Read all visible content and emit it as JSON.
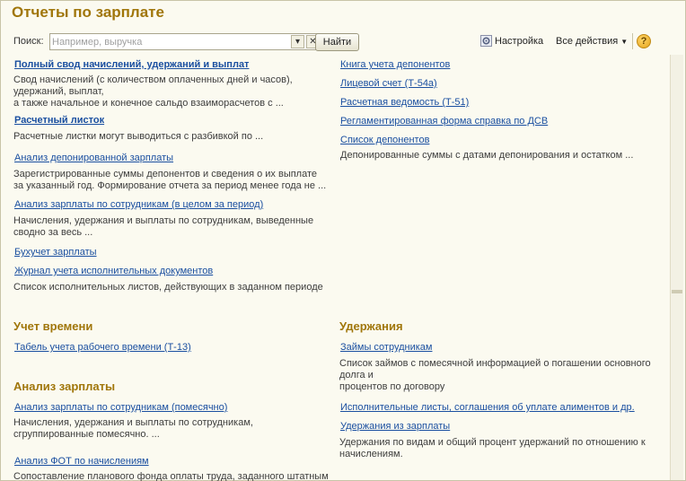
{
  "title": "Отчеты по зарплате",
  "toolbar": {
    "search_label": "Поиск:",
    "search_placeholder": "Например, выручка",
    "find_label": "Найти",
    "settings_label": "Настройка",
    "all_actions_label": "Все действия",
    "help_label": "?"
  },
  "left": {
    "items": [
      {
        "link": "Полный свод начислений, удержаний и выплат",
        "desc": [
          "Свод начислений (с количеством оплаченных дней и часов),",
          "удержаний, выплат,",
          "а также начальное и конечное сальдо взаиморасчетов с ..."
        ]
      },
      {
        "link": "Расчетный листок",
        "desc": [
          "Расчетные листки могут выводиться с разбивкой по ..."
        ]
      },
      {
        "link": "Анализ депонированной зарплаты",
        "desc": [
          "Зарегистрированные суммы депонентов и сведения о их выплате",
          "за указанный год. Формирование отчета за период менее года не ..."
        ]
      },
      {
        "link": "Анализ зарплаты по сотрудникам (в целом за период)",
        "desc": [
          "Начисления, удержания и выплаты по сотрудникам, выведенные",
          "сводно за весь ..."
        ]
      },
      {
        "link": "Бухучет зарплаты",
        "desc": []
      },
      {
        "link": "Журнал учета исполнительных документов",
        "desc": [
          "Список исполнительных листов, действующих в заданном периоде"
        ]
      }
    ]
  },
  "right": {
    "items": [
      {
        "link": "Книга учета депонентов"
      },
      {
        "link": "Лицевой счет (Т-54а)"
      },
      {
        "link": "Расчетная ведомость (Т-51)"
      },
      {
        "link": "Регламентированная форма справка по ДСВ"
      },
      {
        "link": "Список депонентов",
        "desc": [
          "Депонированные суммы с датами депонирования и остатком ..."
        ]
      }
    ]
  },
  "time": {
    "heading": "Учет времени",
    "items": [
      {
        "link": "Табель учета рабочего времени (Т-13)"
      }
    ]
  },
  "analysis": {
    "heading": "Анализ зарплаты",
    "items": [
      {
        "link": "Анализ зарплаты по сотрудникам (помесячно)",
        "desc": [
          "Начисления, удержания и выплаты по сотрудникам,",
          "сгруппированные помесячно. ..."
        ]
      },
      {
        "link": "Анализ ФОТ по начислениям",
        "desc": [
          "Сопоставление планового фонда оплаты труда, заданного штатным"
        ]
      }
    ]
  },
  "deductions": {
    "heading": "Удержания",
    "items": [
      {
        "link": "Займы сотрудникам",
        "desc": [
          "Список займов с помесячной информацией о погашении основного",
          "долга и",
          "процентов по договору"
        ]
      },
      {
        "link": "Исполнительные листы, соглашения об уплате алиментов и др."
      },
      {
        "link": "Удержания из зарплаты",
        "desc": [
          "Удержания по видам и общий процент удержаний по отношению к",
          "начислениям."
        ]
      }
    ]
  }
}
